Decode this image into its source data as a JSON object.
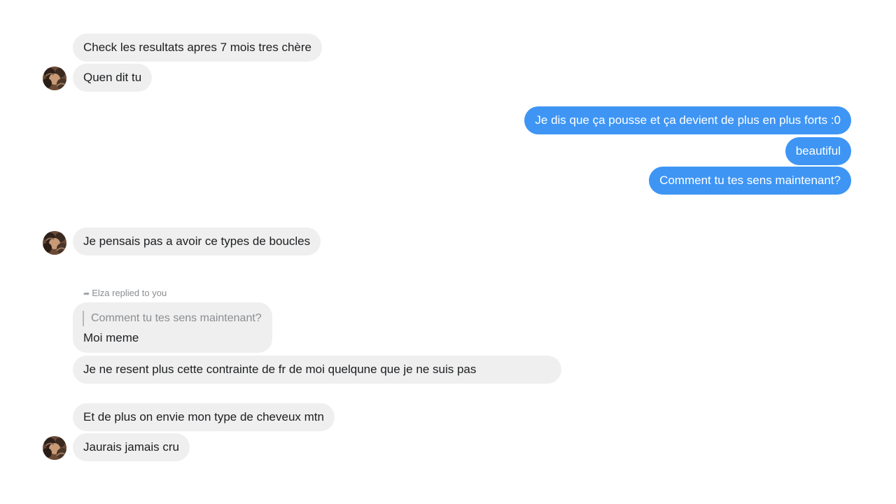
{
  "conversation": {
    "contact_name": "Elza",
    "messages": {
      "m1": "Check les resultats apres 7 mois tres chère",
      "m2": "Quen dit tu",
      "m3": "Je dis que ça pousse et ça devient de plus en plus forts :0",
      "m4": "beautiful",
      "m5": "Comment tu tes sens maintenant?",
      "m6": "Je pensais pas a avoir ce types de boucles",
      "m7_reply_note": "Elza replied to you",
      "m7_quoted": "Comment tu tes sens maintenant?",
      "m7": "Moi meme",
      "m8": "Je ne resent plus cette contrainte de fr de moi quelqune que je ne suis pas",
      "m9": "Et de plus on envie mon type de cheveux mtn",
      "m10": "Jaurais jamais cru"
    }
  },
  "colors": {
    "incoming_bubble": "#efefef",
    "outgoing_bubble": "#3e95f4",
    "reply_note_text": "#8a8d91"
  },
  "icons": {
    "reply": "reply-arrow-icon",
    "avatar": "contact-avatar"
  }
}
